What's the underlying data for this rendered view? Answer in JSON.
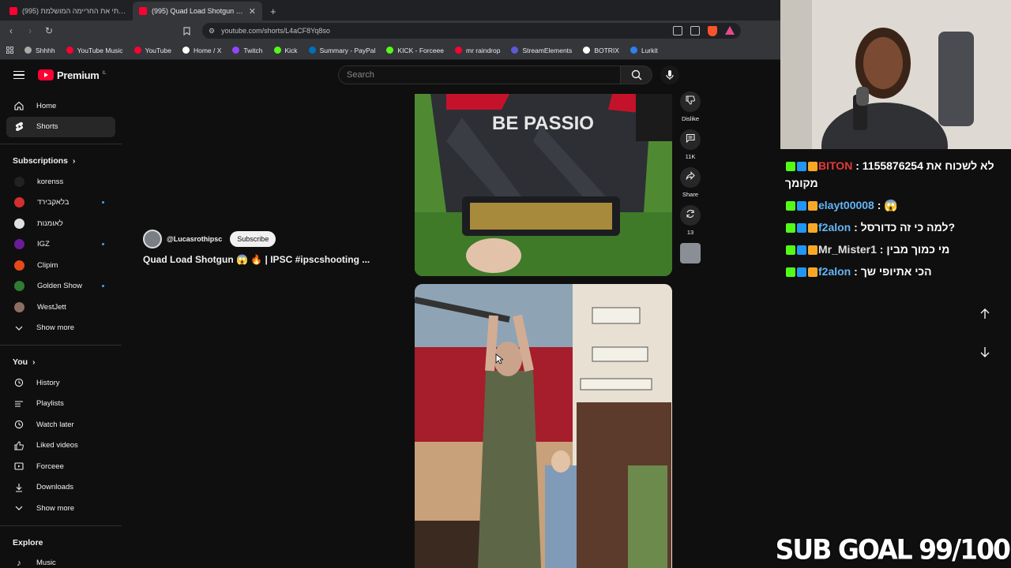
{
  "browser": {
    "tabs": [
      {
        "title": "(995) מצאתי את החריימה המושלמת..",
        "active": false
      },
      {
        "title": "(995) Quad Load Shotgun 😱 |",
        "active": true
      }
    ],
    "url": "youtube.com/shorts/L4aCF8Yq8so",
    "bookmarks": [
      {
        "label": "Shhhh",
        "color": "#aaaaaa"
      },
      {
        "label": "YouTube Music",
        "color": "#ff0033"
      },
      {
        "label": "YouTube",
        "color": "#ff0033"
      },
      {
        "label": "Home / X",
        "color": "#ffffff"
      },
      {
        "label": "Twitch",
        "color": "#9146ff"
      },
      {
        "label": "Kick",
        "color": "#53fc18"
      },
      {
        "label": "Summary - PayPal",
        "color": "#0070ba"
      },
      {
        "label": "KICK - Forceee",
        "color": "#53fc18"
      },
      {
        "label": "mr raindrop",
        "color": "#ff0033"
      },
      {
        "label": "StreamElements",
        "color": "#5b5bd6"
      },
      {
        "label": "BOTRIX",
        "color": "#ffffff"
      },
      {
        "label": "Lurkit",
        "color": "#2f80ed"
      }
    ]
  },
  "youtube": {
    "logo_text": "Premium",
    "logo_sup": "IL",
    "search_placeholder": "Search",
    "sidebar": {
      "main": [
        {
          "label": "Home",
          "icon": "home-icon"
        },
        {
          "label": "Shorts",
          "icon": "shorts-icon",
          "active": true
        }
      ],
      "subscriptions_header": "Subscriptions",
      "subscriptions": [
        {
          "label": "korenss",
          "color": "#222222",
          "dot": false
        },
        {
          "label": "בלאקבירד",
          "color": "#d32f2f",
          "dot": true
        },
        {
          "label": "לאומנות",
          "color": "#e0e0e0",
          "dot": false
        },
        {
          "label": "IGZ",
          "color": "#6a1b9a",
          "dot": true
        },
        {
          "label": "Clipim",
          "color": "#e64a19",
          "dot": false
        },
        {
          "label": "Golden Show",
          "color": "#2e7d32",
          "dot": true
        },
        {
          "label": "WestJett",
          "color": "#8d6e63",
          "dot": false
        }
      ],
      "show_more": "Show more",
      "you_header": "You",
      "you_items": [
        {
          "label": "History",
          "icon": "history-icon"
        },
        {
          "label": "Playlists",
          "icon": "playlists-icon"
        },
        {
          "label": "Watch later",
          "icon": "watch-later-icon"
        },
        {
          "label": "Liked videos",
          "icon": "thumbs-up-icon"
        },
        {
          "label": "Forceee",
          "icon": "video-icon"
        },
        {
          "label": "Downloads",
          "icon": "download-icon"
        }
      ],
      "show_more_2": "Show more",
      "explore_header": "Explore",
      "explore_items": [
        {
          "label": "Music",
          "icon": "music-icon"
        }
      ]
    },
    "short": {
      "channel": "@Lucasrothipsc",
      "subscribe_label": "Subscribe",
      "title": "Quad Load Shotgun 😱 🔥 | IPSC #ipscshooting ...",
      "shirt_text": "BE PASSIO"
    },
    "actions": [
      {
        "label": "Dislike",
        "icon": "thumbs-down-icon"
      },
      {
        "label": "11K",
        "icon": "comment-icon"
      },
      {
        "label": "Share",
        "icon": "share-icon"
      },
      {
        "label": "13",
        "icon": "remix-icon"
      }
    ]
  },
  "overlay": {
    "chat": [
      {
        "user": "BITON",
        "color": "#e53935",
        "message": "1155876254 לא לשכוח את מקומך"
      },
      {
        "user": "elayt00008",
        "color": "#64b5f6",
        "message": "😱"
      },
      {
        "user": "f2alon",
        "color": "#64b5f6",
        "message": "למה כי זה כדורסל?"
      },
      {
        "user": "Mr_Mister1",
        "color": "#e0e0e0",
        "message": "מי כמוך מבין"
      },
      {
        "user": "f2alon",
        "color": "#64b5f6",
        "message": "הכי אתיופי שך"
      }
    ],
    "sub_goal": "SUB GOAL 99/100"
  }
}
